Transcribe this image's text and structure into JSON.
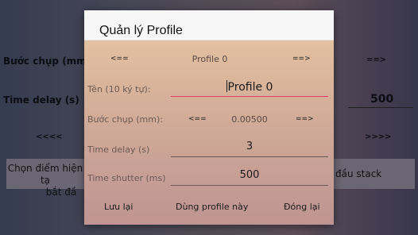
{
  "background": {
    "step_label": "Bước chụp (mm):",
    "step_right_arrow": "==>",
    "time_delay_label": "Time delay (s)",
    "time_delay_value": "500",
    "left_arrows": "<<<<",
    "right_arrows": ">>>>",
    "choose_point_line1": "Chọn điểm hiện tạ",
    "choose_point_line2": "bắt đầ",
    "start_stack": "đầu stack"
  },
  "dialog": {
    "title": "Quản lý Profile",
    "profile_prev": "<==",
    "profile_current": "Profile 0",
    "profile_next": "==>",
    "name_label": "Tên (10 ký tự):",
    "name_value": "Profile 0",
    "step_label": "Bước chụp (mm):",
    "step_prev": "<==",
    "step_value": "0.00500",
    "step_next": "==>",
    "time_delay_label": "Time delay (s)",
    "time_delay_value": "3",
    "time_shutter_label": "Time shutter (ms)",
    "time_shutter_value": "500",
    "save_label": "Lưu lại",
    "use_label": "Dùng profile này",
    "close_label": "Đóng lại"
  },
  "colors": {
    "accent": "#e23b6a",
    "header": "#f6f6f6"
  }
}
